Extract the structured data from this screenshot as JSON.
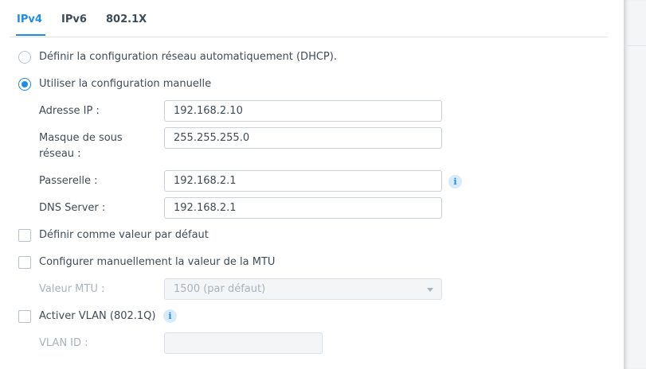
{
  "tabs": [
    "IPv4",
    "IPv6",
    "802.1X"
  ],
  "options": {
    "dhcp_label": "Définir la configuration réseau automatiquement (DHCP).",
    "manual_label": "Utiliser la configuration manuelle",
    "default_label": "Définir comme valeur par défaut",
    "mtu_label": "Configurer manuellement la valeur de la MTU",
    "vlan_label": "Activer VLAN (802.1Q)"
  },
  "fields": {
    "ip_label": "Adresse IP :",
    "ip_value": "192.168.2.10",
    "mask_label_line1": "Masque de sous",
    "mask_label_line2": "réseau :",
    "mask_value": "255.255.255.0",
    "gateway_label": "Passerelle :",
    "gateway_value": "192.168.2.1",
    "dns_label": "DNS Server :",
    "dns_value": "192.168.2.1",
    "mtu_label": "Valeur MTU :",
    "mtu_value": "1500 (par défaut)",
    "vlan_id_label": "VLAN ID :",
    "vlan_id_value": ""
  },
  "state": {
    "selected_mode": "manual",
    "set_default_checked": false,
    "manual_mtu_checked": false,
    "vlan_checked": false
  },
  "colors": {
    "accent": "#1f8ce6",
    "text": "#414b55",
    "disabled_text": "#a9b3bd"
  },
  "icons": {
    "info": "i"
  }
}
